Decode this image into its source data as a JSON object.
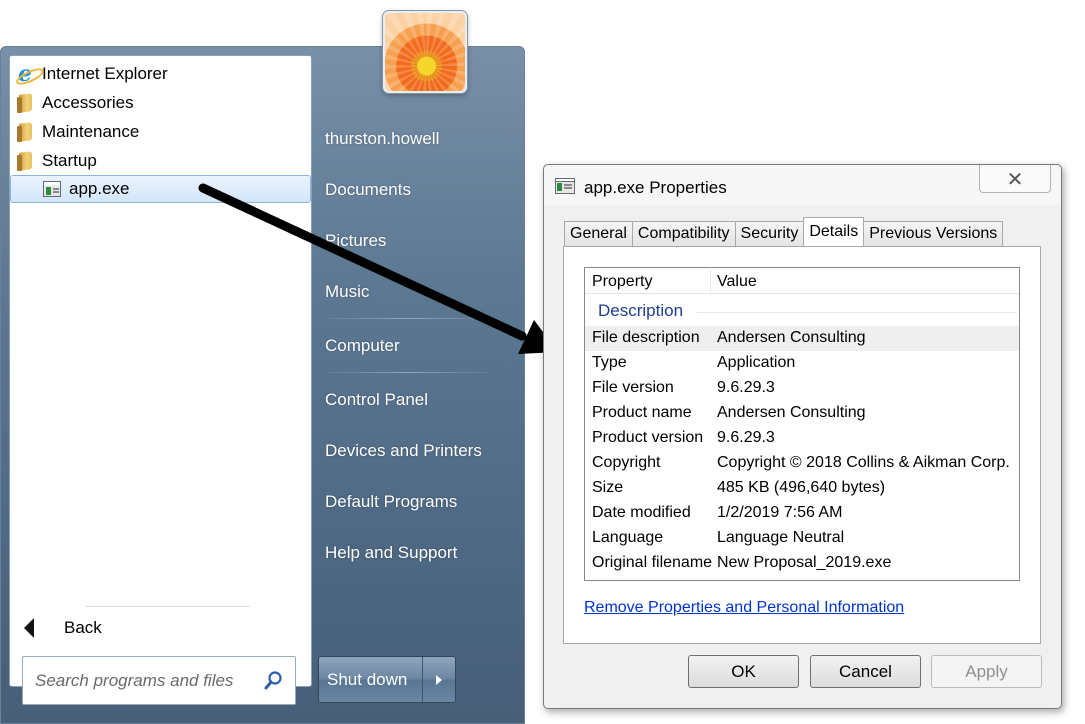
{
  "start_menu": {
    "programs": [
      {
        "label": "Internet Explorer",
        "icon": "internet-explorer-icon"
      },
      {
        "label": "Accessories",
        "icon": "folder-icon"
      },
      {
        "label": "Maintenance",
        "icon": "folder-icon"
      },
      {
        "label": "Startup",
        "icon": "folder-icon"
      },
      {
        "label": "app.exe",
        "icon": "app-icon",
        "selected": true
      }
    ],
    "back_label": "Back",
    "search_placeholder": "Search programs and files",
    "right_items": [
      "thurston.howell",
      "Documents",
      "Pictures",
      "Music",
      "Computer",
      "Control Panel",
      "Devices and Printers",
      "Default Programs",
      "Help and Support"
    ],
    "shutdown_label": "Shut down"
  },
  "dialog": {
    "title": "app.exe Properties",
    "close_symbol": "✕",
    "tabs": [
      "General",
      "Compatibility",
      "Security",
      "Details",
      "Previous Versions"
    ],
    "active_tab": "Details",
    "columns": {
      "property": "Property",
      "value": "Value"
    },
    "group": "Description",
    "rows": [
      {
        "k": "File description",
        "v": "Andersen Consulting"
      },
      {
        "k": "Type",
        "v": "Application"
      },
      {
        "k": "File version",
        "v": "9.6.29.3"
      },
      {
        "k": "Product name",
        "v": "Andersen Consulting"
      },
      {
        "k": "Product version",
        "v": "9.6.29.3"
      },
      {
        "k": "Copyright",
        "v": "Copyright © 2018 Collins & Aikman Corp."
      },
      {
        "k": "Size",
        "v": "485 KB (496,640 bytes)"
      },
      {
        "k": "Date modified",
        "v": "1/2/2019 7:56 AM"
      },
      {
        "k": "Language",
        "v": "Language Neutral"
      },
      {
        "k": "Original filename",
        "v": "New Proposal_2019.exe"
      }
    ],
    "link": "Remove Properties and Personal Information",
    "buttons": {
      "ok": "OK",
      "cancel": "Cancel",
      "apply": "Apply"
    }
  },
  "colors": {
    "accent_link": "#0033cc",
    "group_header": "#1e3e94",
    "start_menu_blue": "#5d7892"
  }
}
